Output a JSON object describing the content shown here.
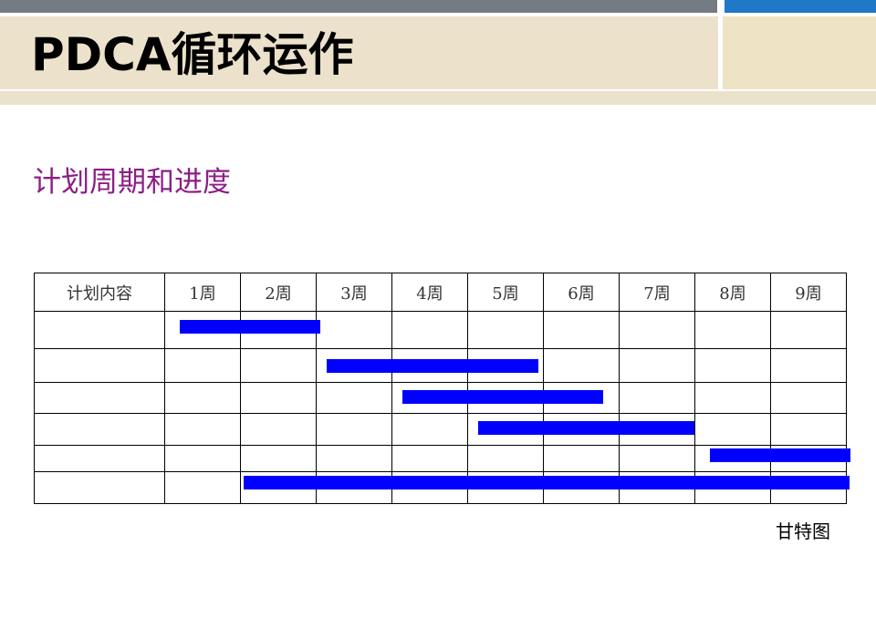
{
  "slide": {
    "title": "PDCA循环运作",
    "subtitle": "计划周期和进度",
    "caption": "甘特图"
  },
  "colors": {
    "header_band": "#ECE2CB",
    "top_bar_gray": "#747B82",
    "top_bar_blue": "#1F78C8",
    "subtitle": "#8B1F86",
    "bar": "#0000FF"
  },
  "gantt": {
    "header": [
      "计划内容",
      "1周",
      "2周",
      "3周",
      "4周",
      "5周",
      "6周",
      "7周",
      "8周",
      "9周"
    ],
    "tasks": [
      {
        "label": "",
        "start_week": 1.2,
        "end_week": 3.05
      },
      {
        "label": "",
        "start_week": 3.15,
        "end_week": 5.95
      },
      {
        "label": "",
        "start_week": 4.15,
        "end_week": 6.8
      },
      {
        "label": "",
        "start_week": 5.15,
        "end_week": 8.0
      },
      {
        "label": "",
        "start_week": 8.2,
        "end_week": 10.05
      },
      {
        "label": "",
        "start_week": 2.05,
        "end_week": 10.05
      }
    ]
  }
}
